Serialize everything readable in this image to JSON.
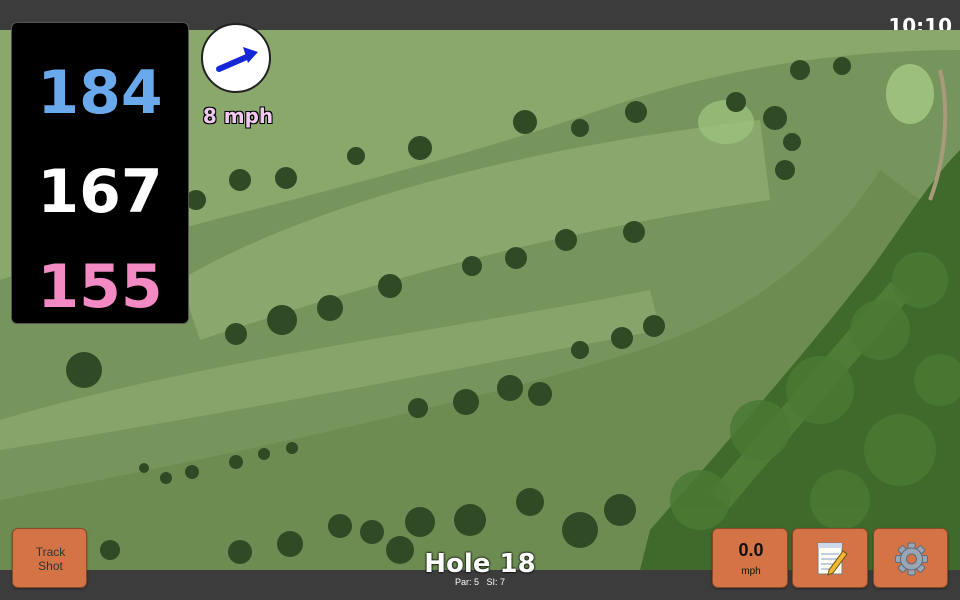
{
  "status": {
    "time": "10:10"
  },
  "yardages": {
    "back": "184",
    "middle": "167",
    "front": "155"
  },
  "wind": {
    "speed_label": "8 mph",
    "direction_icon": "arrow-icon"
  },
  "buttons": {
    "track_shot_label": "Track\nShot",
    "wind_value": "0.0",
    "wind_unit": "mph",
    "notes_icon": "notepad-icon",
    "settings_icon": "gear-icon"
  },
  "hole": {
    "title": "Hole 18",
    "par_label": "Par: 5",
    "si_label": "SI: 7"
  },
  "colors": {
    "back_yardage": "#6aa9ec",
    "middle_yardage": "#ffffff",
    "front_yardage": "#f48ac4",
    "wind_arrow": "#1428d8",
    "wind_speed_text": "#f0c8f0",
    "button_bg": "#d47446",
    "fairway": "#86a86a",
    "rough": "#6f9056",
    "trees": "#2f4a25"
  }
}
